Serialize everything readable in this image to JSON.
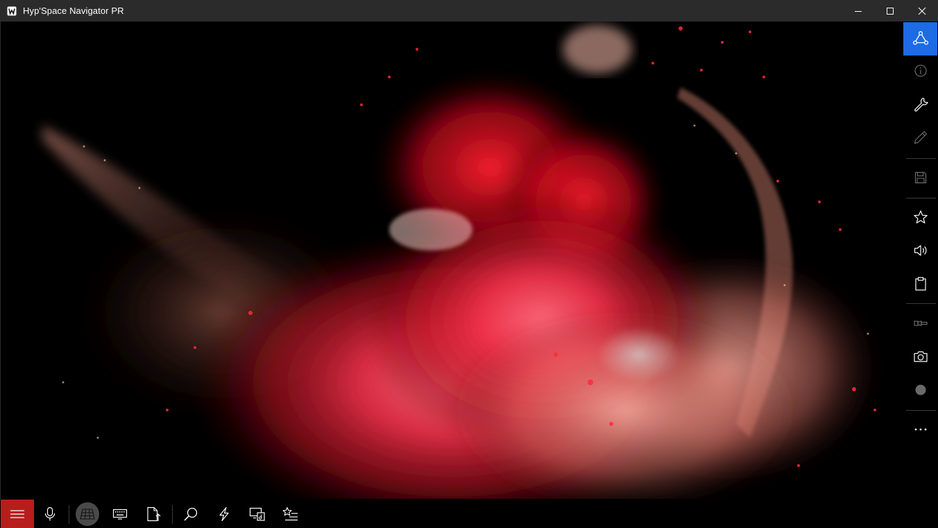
{
  "window": {
    "title": "Hyp'Space Navigator PR",
    "controls": [
      "minimize",
      "maximize",
      "close"
    ]
  },
  "sidebar": {
    "items": [
      {
        "name": "network-hub",
        "icon": "triangle-network-icon",
        "active": true
      },
      {
        "name": "info",
        "icon": "info-icon",
        "active": false
      },
      {
        "name": "settings",
        "icon": "wrench-icon",
        "active": false
      },
      {
        "name": "edit",
        "icon": "pencil-icon",
        "active": false
      },
      {
        "name": "save",
        "icon": "floppy-icon",
        "active": false
      },
      {
        "name": "favorites",
        "icon": "star-icon",
        "active": false
      },
      {
        "name": "volume",
        "icon": "speaker-icon",
        "active": false
      },
      {
        "name": "clipboard",
        "icon": "clipboard-icon",
        "active": false
      },
      {
        "name": "flashlight",
        "icon": "flashlight-icon",
        "active": false
      },
      {
        "name": "camera",
        "icon": "camera-icon",
        "active": false
      },
      {
        "name": "record",
        "icon": "record-dot-icon",
        "active": false
      },
      {
        "name": "more",
        "icon": "more-icon",
        "active": false
      }
    ],
    "more_label": "..."
  },
  "bottombar": {
    "items": [
      {
        "name": "menu",
        "icon": "hamburger-icon"
      },
      {
        "name": "microphone",
        "icon": "microphone-icon"
      },
      {
        "name": "grid",
        "icon": "grid-icon"
      },
      {
        "name": "keyboard",
        "icon": "keyboard-icon"
      },
      {
        "name": "upload",
        "icon": "file-upload-icon"
      },
      {
        "name": "search",
        "icon": "search-icon"
      },
      {
        "name": "quick-action",
        "icon": "lightning-icon"
      },
      {
        "name": "media",
        "icon": "media-device-icon"
      },
      {
        "name": "favorites-list",
        "icon": "star-list-icon"
      }
    ]
  },
  "colors": {
    "titlebar": "#2b2b2b",
    "active_accent": "#1e6be6",
    "menu_accent": "#b81d1d",
    "background": "#000000"
  }
}
